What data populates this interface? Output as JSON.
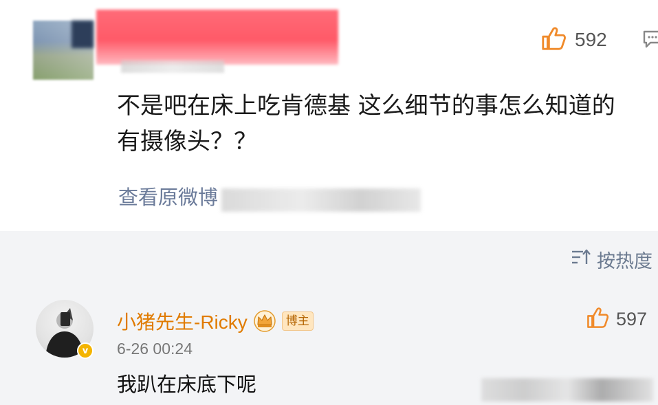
{
  "comment": {
    "likes": "592",
    "text": "不是吧在床上吃肯德基 这么细节的事怎么知道的\n有摄像头？？",
    "view_original": "查看原微博",
    "view_original_visible": "查看原微博"
  },
  "sort": {
    "label": "按热度"
  },
  "reply": {
    "username": "小猪先生-Ricky",
    "badge": "博主",
    "time": "6-26 00:24",
    "text": "我趴在床底下呢",
    "likes": "597"
  },
  "icons": {
    "like": "thumbs-up-icon",
    "comment": "comment-icon",
    "sort": "sort-icon",
    "crown": "crown-icon",
    "verified": "verified-icon"
  },
  "colors": {
    "like_icon": "#f08a2a",
    "username": "#e07b00",
    "link": "#6a7a99",
    "badge_bg": "#ffe6bf"
  }
}
